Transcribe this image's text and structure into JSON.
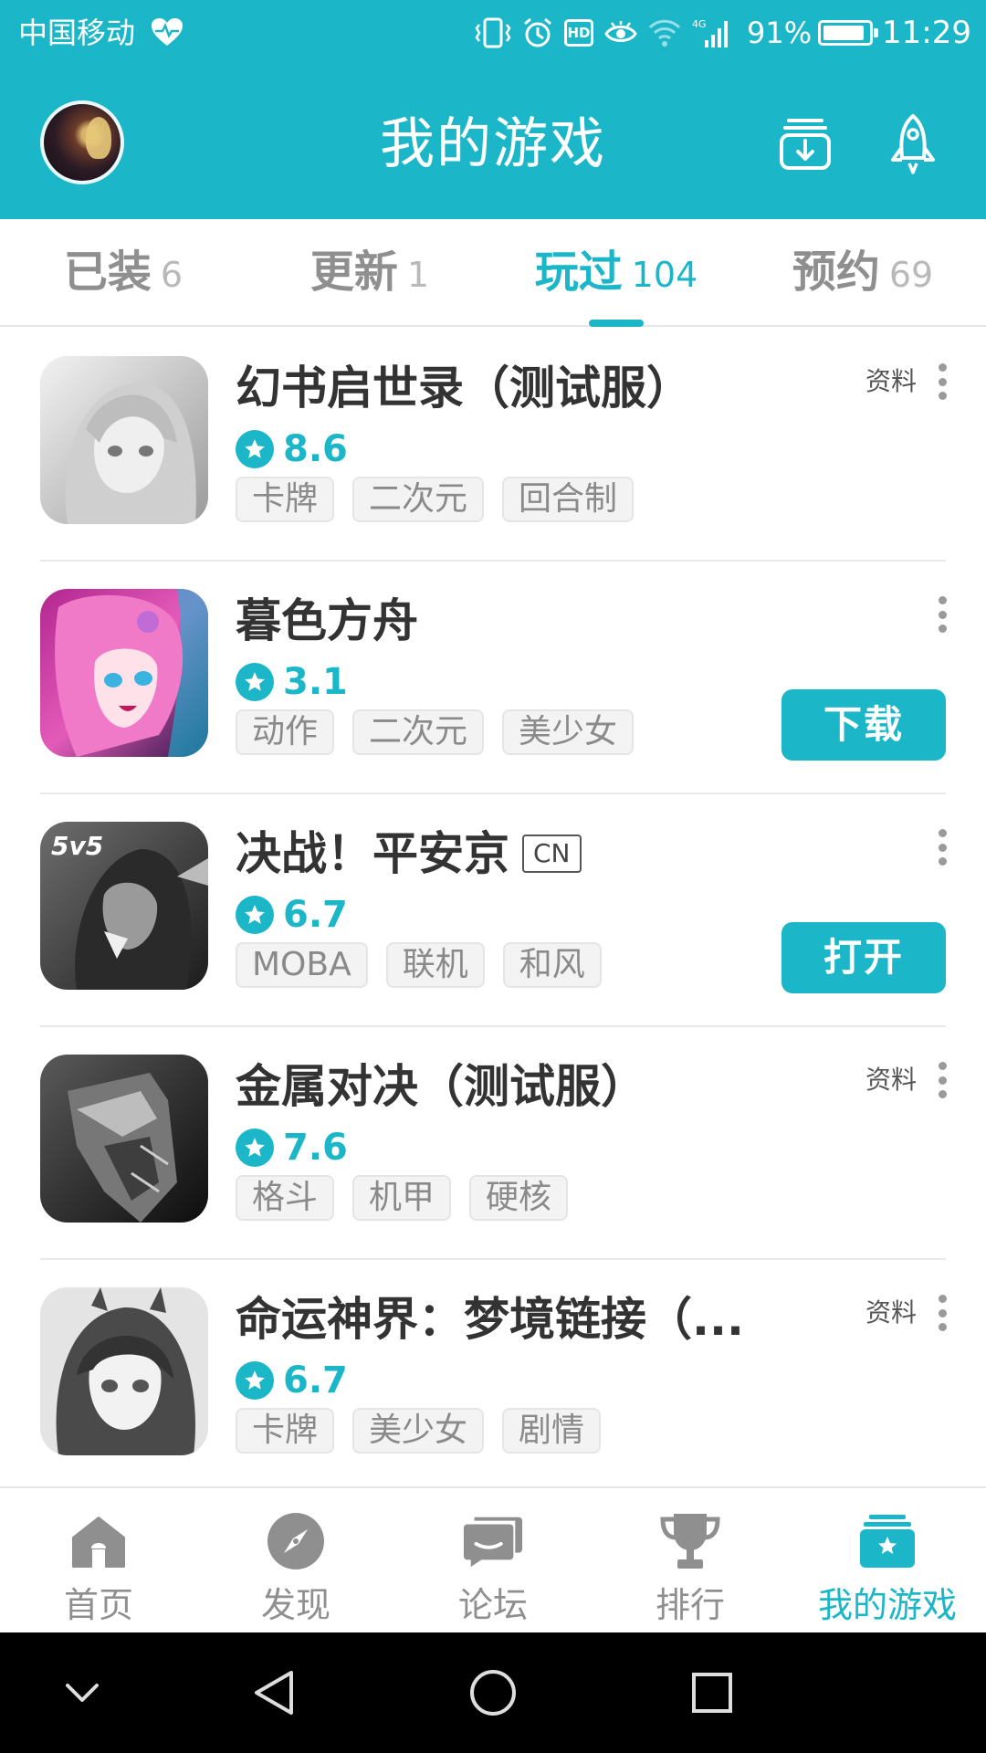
{
  "status_bar": {
    "carrier": "中国移动",
    "network": "4G",
    "hd_badge": "HD",
    "battery_percent": "91%",
    "battery_level": 0.91,
    "time": "11:29",
    "icons": [
      "heart-pulse-icon",
      "vibrate-icon",
      "alarm-icon",
      "hd-icon",
      "eye-icon",
      "wifi-icon",
      "signal-icon",
      "battery-icon"
    ]
  },
  "header": {
    "title": "我的游戏",
    "left_icon": "avatar",
    "right_icons": [
      "download-tray-icon",
      "rocket-icon"
    ]
  },
  "tabs": [
    {
      "label": "已装",
      "count": "6"
    },
    {
      "label": "更新",
      "count": "1"
    },
    {
      "label": "玩过",
      "count": "104",
      "active": true
    },
    {
      "label": "预约",
      "count": "69"
    }
  ],
  "games": [
    {
      "title": "幻书启世录（测试服）",
      "rating": "8.6",
      "tags": [
        "卡牌",
        "二次元",
        "回合制"
      ],
      "info_label": "资料"
    },
    {
      "title": "暮色方舟",
      "rating": "3.1",
      "tags": [
        "动作",
        "二次元",
        "美少女"
      ],
      "action_label": "下载"
    },
    {
      "title": "决战！平安京",
      "badge": "CN",
      "rating": "6.7",
      "tags": [
        "MOBA",
        "联机",
        "和风"
      ],
      "action_label": "打开"
    },
    {
      "title": "金属对决（测试服）",
      "rating": "7.6",
      "tags": [
        "格斗",
        "机甲",
        "硬核"
      ],
      "info_label": "资料"
    },
    {
      "title": "命运神界：梦境链接（...",
      "rating": "6.7",
      "tags": [
        "卡牌",
        "美少女",
        "剧情"
      ],
      "info_label": "资料"
    }
  ],
  "game_icon_art": {
    "g0": "5v5"
  },
  "bottom_nav": [
    {
      "label": "首页",
      "icon": "home-icon"
    },
    {
      "label": "发现",
      "icon": "compass-icon"
    },
    {
      "label": "论坛",
      "icon": "forum-icon"
    },
    {
      "label": "排行",
      "icon": "trophy-icon"
    },
    {
      "label": "我的游戏",
      "icon": "my-games-icon",
      "active": true
    }
  ],
  "system_nav": [
    "back-chevron-icon",
    "back-triangle-icon",
    "home-circle-icon",
    "recents-square-icon"
  ],
  "colors": {
    "accent": "#1bb7c8",
    "text_dark": "#333333",
    "text_muted": "#8f8f8f"
  }
}
